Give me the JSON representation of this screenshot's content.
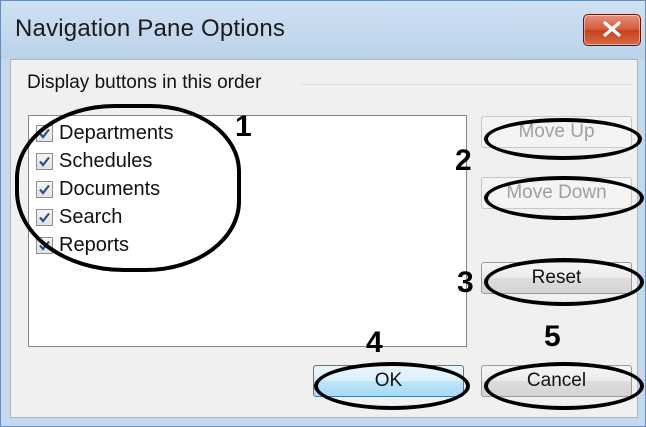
{
  "window": {
    "title": "Navigation Pane Options",
    "close_icon": "close-icon",
    "close_color": "#c7401f"
  },
  "group": {
    "label": "Display buttons in this order"
  },
  "list": {
    "items": [
      {
        "label": "Departments",
        "checked": true
      },
      {
        "label": "Schedules",
        "checked": true
      },
      {
        "label": "Documents",
        "checked": true
      },
      {
        "label": "Search",
        "checked": true
      },
      {
        "label": "Reports",
        "checked": true
      }
    ]
  },
  "buttons": {
    "move_up": "Move Up",
    "move_down": "Move Down",
    "reset": "Reset",
    "ok": "OK",
    "cancel": "Cancel"
  },
  "callouts": {
    "one": "1",
    "two": "2",
    "three": "3",
    "four": "4",
    "five": "5"
  }
}
